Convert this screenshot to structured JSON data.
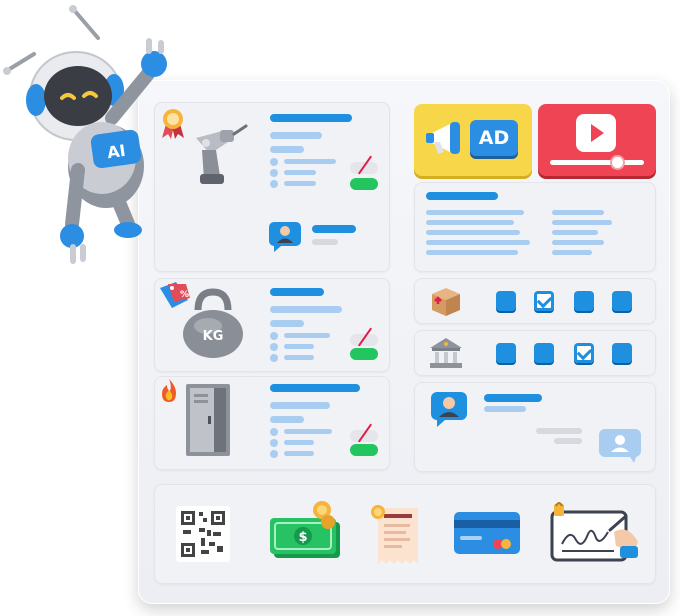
{
  "ad_label": "AD",
  "robot_label": "AI",
  "kettlebell_label": "KG",
  "tag_label": "%",
  "colors": {
    "accent": "#1f8fe0",
    "soft": "#a9cdf0",
    "green": "#22c55e",
    "red": "#ef4453",
    "yellow": "#f7d64a"
  },
  "checkbox_rows": [
    {
      "icon": "package-icon",
      "states": [
        false,
        true,
        false,
        false
      ]
    },
    {
      "icon": "bank-icon",
      "states": [
        false,
        false,
        true,
        false
      ]
    }
  ],
  "bottom_icons": [
    "qr-code-icon",
    "cash-icon",
    "receipt-icon",
    "credit-card-icon",
    "signature-tablet-icon"
  ]
}
